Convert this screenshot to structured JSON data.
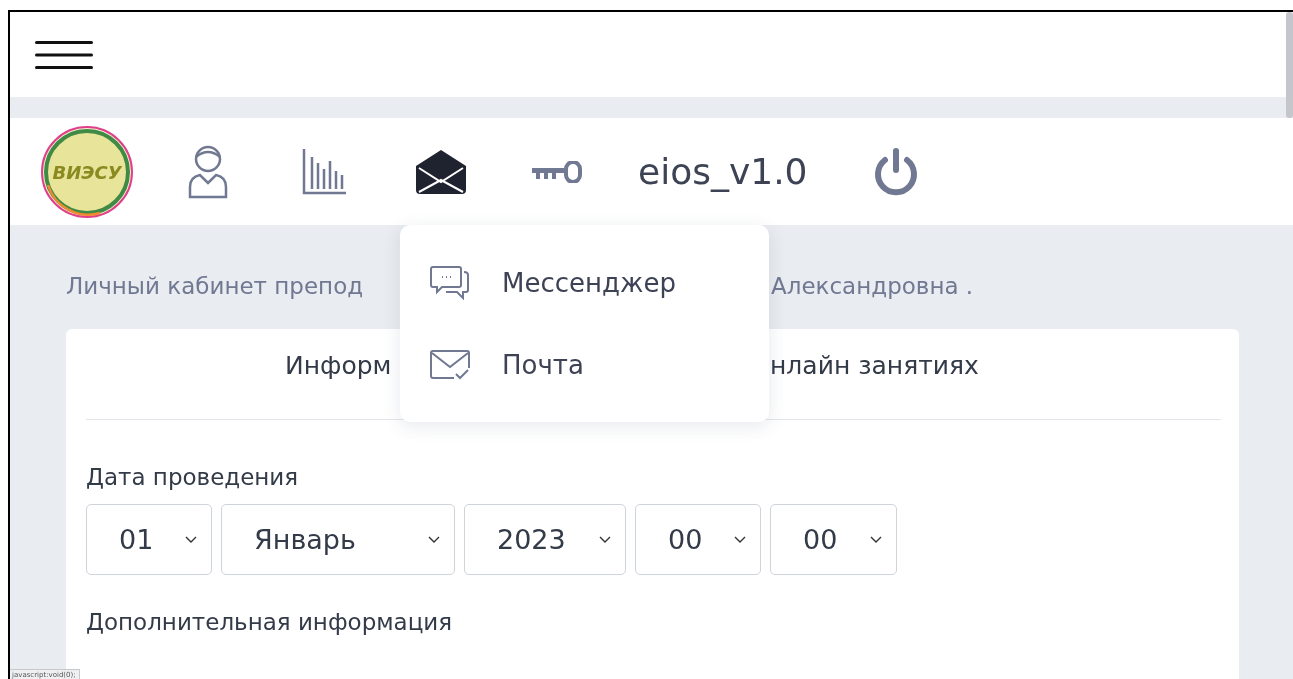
{
  "navbar": {
    "logo_text": "ВИЭСУ",
    "icons": [
      {
        "kind": "user",
        "selected": false
      },
      {
        "kind": "chart",
        "selected": false
      },
      {
        "kind": "mail",
        "selected": true
      },
      {
        "kind": "key",
        "selected": false
      }
    ],
    "brand": "eios_v1.0"
  },
  "dropdown": {
    "items": [
      {
        "kind": "messenger",
        "label": "Мессенджер"
      },
      {
        "kind": "mail",
        "label": "Почта"
      }
    ]
  },
  "greeting": {
    "left": "Личный кабинет препод",
    "right": "Александровна ."
  },
  "card": {
    "title_left": "Информ",
    "title_right": "нлайн занятиях",
    "date_label": "Дата проведения",
    "selects": [
      {
        "value": "01"
      },
      {
        "value": "Январь"
      },
      {
        "value": "2023"
      },
      {
        "value": "00"
      },
      {
        "value": "00"
      }
    ],
    "extra_label": "Дополнительная информация"
  },
  "status_url": "javascript:void(0);"
}
